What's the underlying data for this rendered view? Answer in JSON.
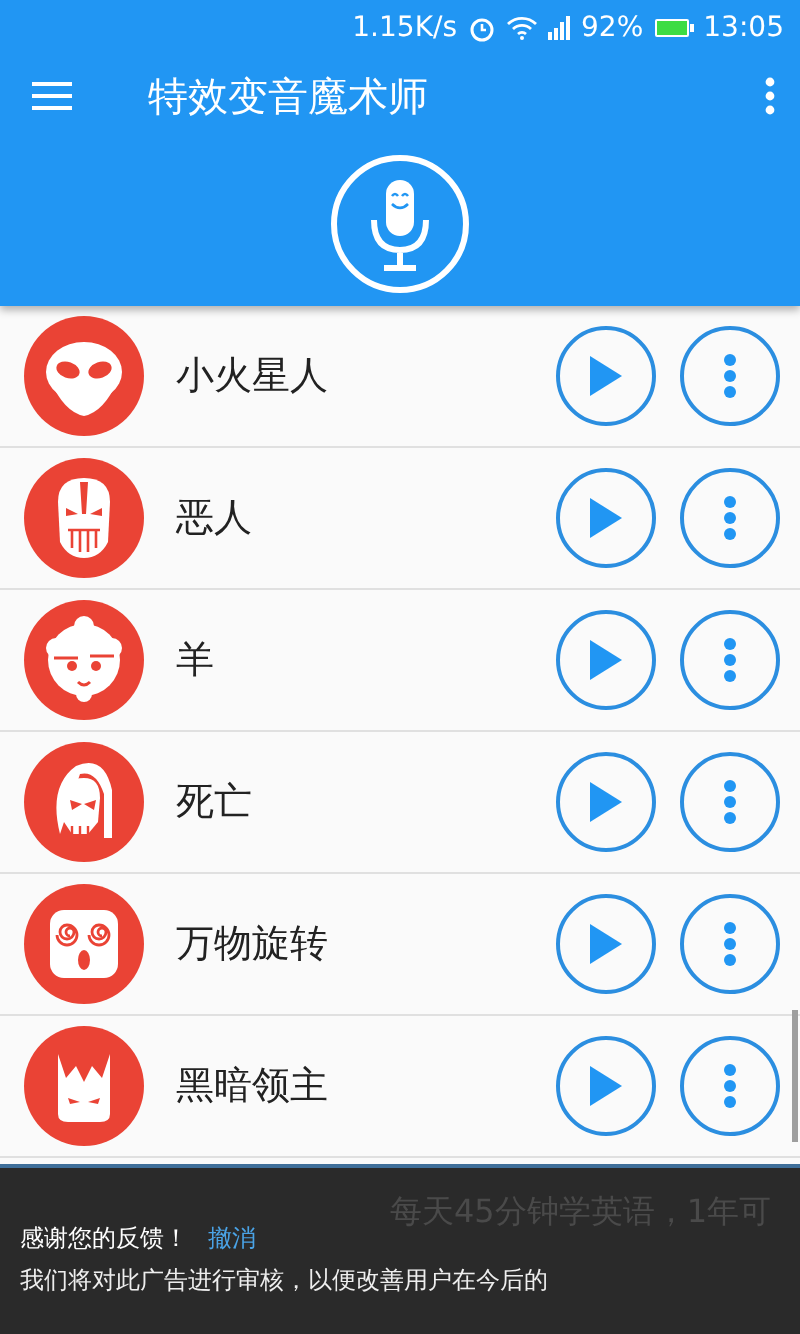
{
  "status_bar": {
    "speed": "1.15K/s",
    "battery": "92%",
    "time": "13:05"
  },
  "app_bar": {
    "title": "特效变音魔术师"
  },
  "effects": [
    {
      "name": "小火星人",
      "kind": "alien"
    },
    {
      "name": "恶人",
      "kind": "villain"
    },
    {
      "name": "羊",
      "kind": "sheep"
    },
    {
      "name": "死亡",
      "kind": "death"
    },
    {
      "name": "万物旋转",
      "kind": "dizzy"
    },
    {
      "name": "黑暗领主",
      "kind": "lord"
    }
  ],
  "ad_feedback": {
    "background_text": "每天45分钟学英语，1年可",
    "message": "感谢您的反馈！",
    "undo": "撤消",
    "note": "我们将对此广告进行审核，以便改善用户在今后的"
  }
}
